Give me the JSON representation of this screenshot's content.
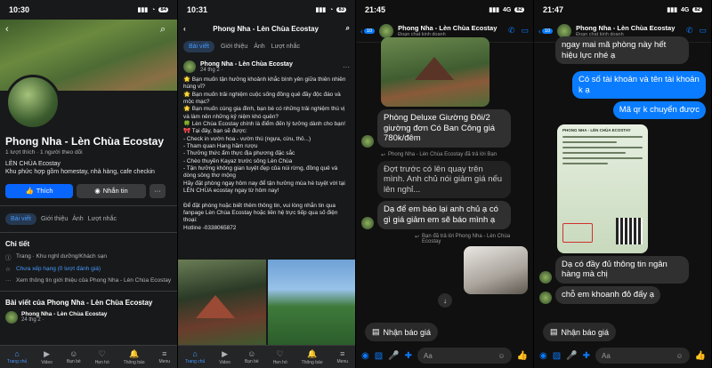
{
  "phone1": {
    "time": "10:30",
    "battery": "84",
    "page_name": "Phong Nha - Lèn Chùa Ecostay",
    "likes": "1 lượt thích",
    "followers": "1 người theo dõi",
    "bio_title": "LÈN CHÙA Ecostay",
    "bio_text": "Khu phức hợp gồm homestay, nhà hàng, cafe checkin",
    "like_button": "Thích",
    "message_button": "Nhắn tin",
    "more_button": "···",
    "tabs": [
      "Bài viết",
      "Giới thiệu",
      "Ảnh",
      "Lượt nhắc"
    ],
    "details_title": "Chi tiết",
    "details": [
      {
        "text": "Trang · Khu nghỉ dưỡng/Khách sạn",
        "link": ""
      },
      {
        "text": "",
        "link": "Chưa xếp hạng (0 lượt đánh giá)"
      },
      {
        "text": "Xem thông tin giới thiệu của Phong Nha - Lèn Chùa Ecostay",
        "link": ""
      }
    ],
    "posts_title": "Bài viết của Phong Nha - Lèn Chùa Ecostay",
    "post_author": "Phong Nha - Lèn Chùa Ecostay",
    "post_time": "24 thg 2 · ",
    "nav": [
      "Trang chủ",
      "Video",
      "Bạn bè",
      "Hẹn hò",
      "Thông báo",
      "Menu"
    ]
  },
  "phone2": {
    "time": "10:31",
    "battery": "83",
    "title": "Phong Nha - Lèn Chùa Ecostay",
    "tabs": [
      "Bài viết",
      "Giới thiệu",
      "Ảnh",
      "Lượt nhắc"
    ],
    "author": "Phong Nha - Lèn Chùa Ecostay",
    "time_posted": "24 thg 2 · ",
    "text": "🌟 Bạn muốn tận hưởng khoảnh khắc bình yên giữa thiên nhiên hùng vĩ?\n🌟 Bạn muốn trải nghiệm cuộc sống đồng quê đầy độc đáo và mộc mạc?\n🌟 Bạn muốn cùng gia đình, bạn bè có những trải nghiệm thú vị và làm nên những kỷ niệm khó quên?\n🍀 Lèn Chùa Ecostay chính là điểm đến lý tưởng dành cho bạn!\n🎀 Tại đây, bạn sẽ được:\n- Check in vườn hoa - vườn thú (ngựa, cừu, thỏ...)\n- Tham quan Hang hầm rượu\n- Thưởng thức ẩm thực địa phương đặc sắc\n- Chèo thuyền Kayaz trước sông Lèn Chùa\n- Tận hưởng không gian tuyệt đẹp của núi rừng, đồng quê và dòng sông thơ mộng\nHãy đặt phòng ngay hôm nay để tận hưởng mùa hè tuyệt vời tại LÈN CHÙA ecostay ngay từ hôm nay!\n\nĐể đặt phòng hoặc biết thêm thông tin, vui lòng nhắn tin qua fanpage Lèn Chùa Ecostay hoặc liên hệ trực tiếp qua số điện thoại:\nHotline -0338065872",
    "nav": [
      "Trang chủ",
      "Video",
      "Bạn bè",
      "Hẹn hò",
      "Thông báo",
      "Menu"
    ]
  },
  "phone3": {
    "time": "21:45",
    "network": "4G",
    "battery": "82",
    "back_count": "10",
    "contact": "Phong Nha - Lèn Chùa Ecostay",
    "subtitle": "Đoạn chat kinh doanh",
    "msg_offer": "Phòng Deluxe Giường Đôi/2 giường đơn Có Ban Công giá 780k/đêm",
    "reply_note": "Phong Nha - Lèn Chùa Ecostay đã trả lời Bạn",
    "msg_quote": "Đợt trước có lên quay trên mình. Anh chủ nói giảm giá nếu lên nghỉ...",
    "msg_reply": "Dạ để em báo lại anh chủ ạ có gì giá giảm em sẽ báo mình ạ",
    "reply_note2": "Bạn đã trả lời Phong Nha - Lèn Chùa Ecostay",
    "quick_reply": "Nhận báo giá",
    "composer_placeholder": "Aa"
  },
  "phone4": {
    "time": "21:47",
    "network": "4G",
    "battery": "82",
    "back_count": "10",
    "contact": "Phong Nha - Lèn Chùa Ecostay",
    "subtitle": "Đoạn chat kinh doanh",
    "msg_expire": "ngay mai mã phòng này hết hiệu lực nhé ạ",
    "msg_out1": "Có số tài khoản và tên tài khoản k ạ",
    "msg_out2": "Mã qr k chuyển được",
    "bill_title": "PHONG NHA - LÈN CHÙA ECOSTAY",
    "msg_in1": "Dạ có đầy đủ thông tin ngân hàng mà chị",
    "msg_in2": "chỗ em khoanh đỏ đấy ạ",
    "quick_reply": "Nhận báo giá",
    "composer_placeholder": "Aa"
  }
}
